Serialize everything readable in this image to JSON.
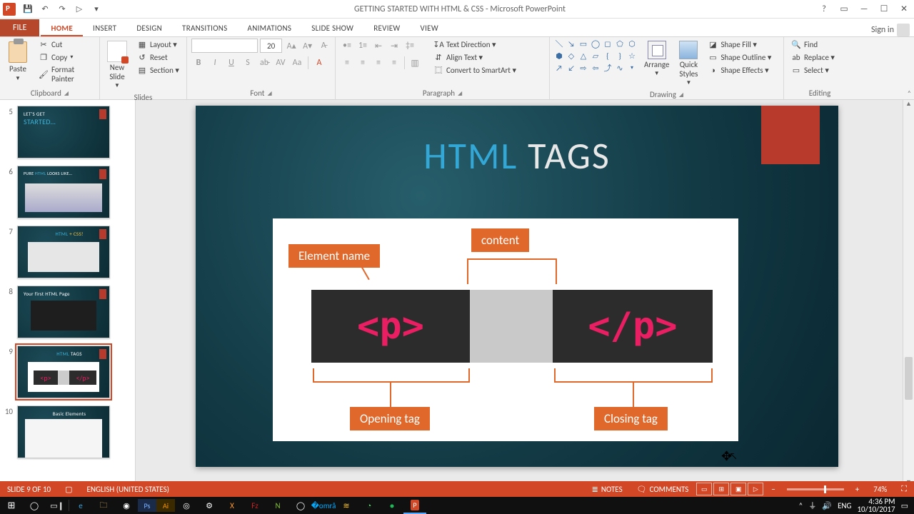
{
  "title": "GETTING STARTED WITH HTML & CSS - Microsoft PowerPoint",
  "qat": {
    "save": "💾",
    "undo": "↶",
    "redo": "↷",
    "start": "▷",
    "more": "▾"
  },
  "syswin": {
    "help": "?",
    "ropts": "▭",
    "min": "—",
    "max": "☐",
    "close": "✕"
  },
  "ribbon": {
    "file": "FILE",
    "tabs": [
      "HOME",
      "INSERT",
      "DESIGN",
      "TRANSITIONS",
      "ANIMATIONS",
      "SLIDE SHOW",
      "REVIEW",
      "VIEW"
    ],
    "active": 0,
    "signin": "Sign in"
  },
  "groups": {
    "clipboard": {
      "label": "Clipboard",
      "paste": "Paste",
      "cut": "Cut",
      "copy": "Copy",
      "format_painter": "Format Painter"
    },
    "slides": {
      "label": "Slides",
      "new_slide": "New\nSlide",
      "layout": "Layout ▾",
      "reset": "Reset",
      "section": "Section ▾"
    },
    "font": {
      "label": "Font",
      "size": "20"
    },
    "paragraph": {
      "label": "Paragraph",
      "text_direction": "Text Direction ▾",
      "align_text": "Align Text ▾",
      "smartart": "Convert to SmartArt ▾"
    },
    "drawing": {
      "label": "Drawing",
      "arrange": "Arrange",
      "quick_styles": "Quick\nStyles",
      "shape_fill": "Shape Fill ▾",
      "shape_outline": "Shape Outline ▾",
      "shape_effects": "Shape Effects ▾"
    },
    "editing": {
      "label": "Editing",
      "find": "Find",
      "replace": "Replace ▾",
      "select": "Select ▾"
    }
  },
  "thumbs": [
    {
      "n": 5,
      "line1": "LET'S GET",
      "line2": "STARTED…",
      "hl2": true
    },
    {
      "n": 6,
      "line1": "PURE HTML LOOKS LIKE…",
      "img": true
    },
    {
      "n": 7,
      "line1": "HTML + CSS!",
      "hl1": "HTML",
      "img": true
    },
    {
      "n": 8,
      "line1": "Your first HTML Page",
      "dark": true
    },
    {
      "n": 9,
      "line1": "HTML TAGS",
      "hl1": "HTML",
      "sel": true,
      "diag": true
    },
    {
      "n": 10,
      "line1": "Basic Elements",
      "light": true
    }
  ],
  "slide": {
    "title_hl": "HTML",
    "title_rest": "TAGS",
    "labels": {
      "element": "Element name",
      "content": "content",
      "opening": "Opening tag",
      "closing": "Closing tag"
    },
    "open_tag": "<p>",
    "close_tag": "</p>"
  },
  "status": {
    "slide": "SLIDE 9 OF 10",
    "lang": "ENGLISH (UNITED STATES)",
    "notes": "NOTES",
    "comments": "COMMENTS",
    "zoom": "74%"
  },
  "tray": {
    "lang": "ENG",
    "time": "4:36 PM",
    "date": "10/10/2017"
  }
}
